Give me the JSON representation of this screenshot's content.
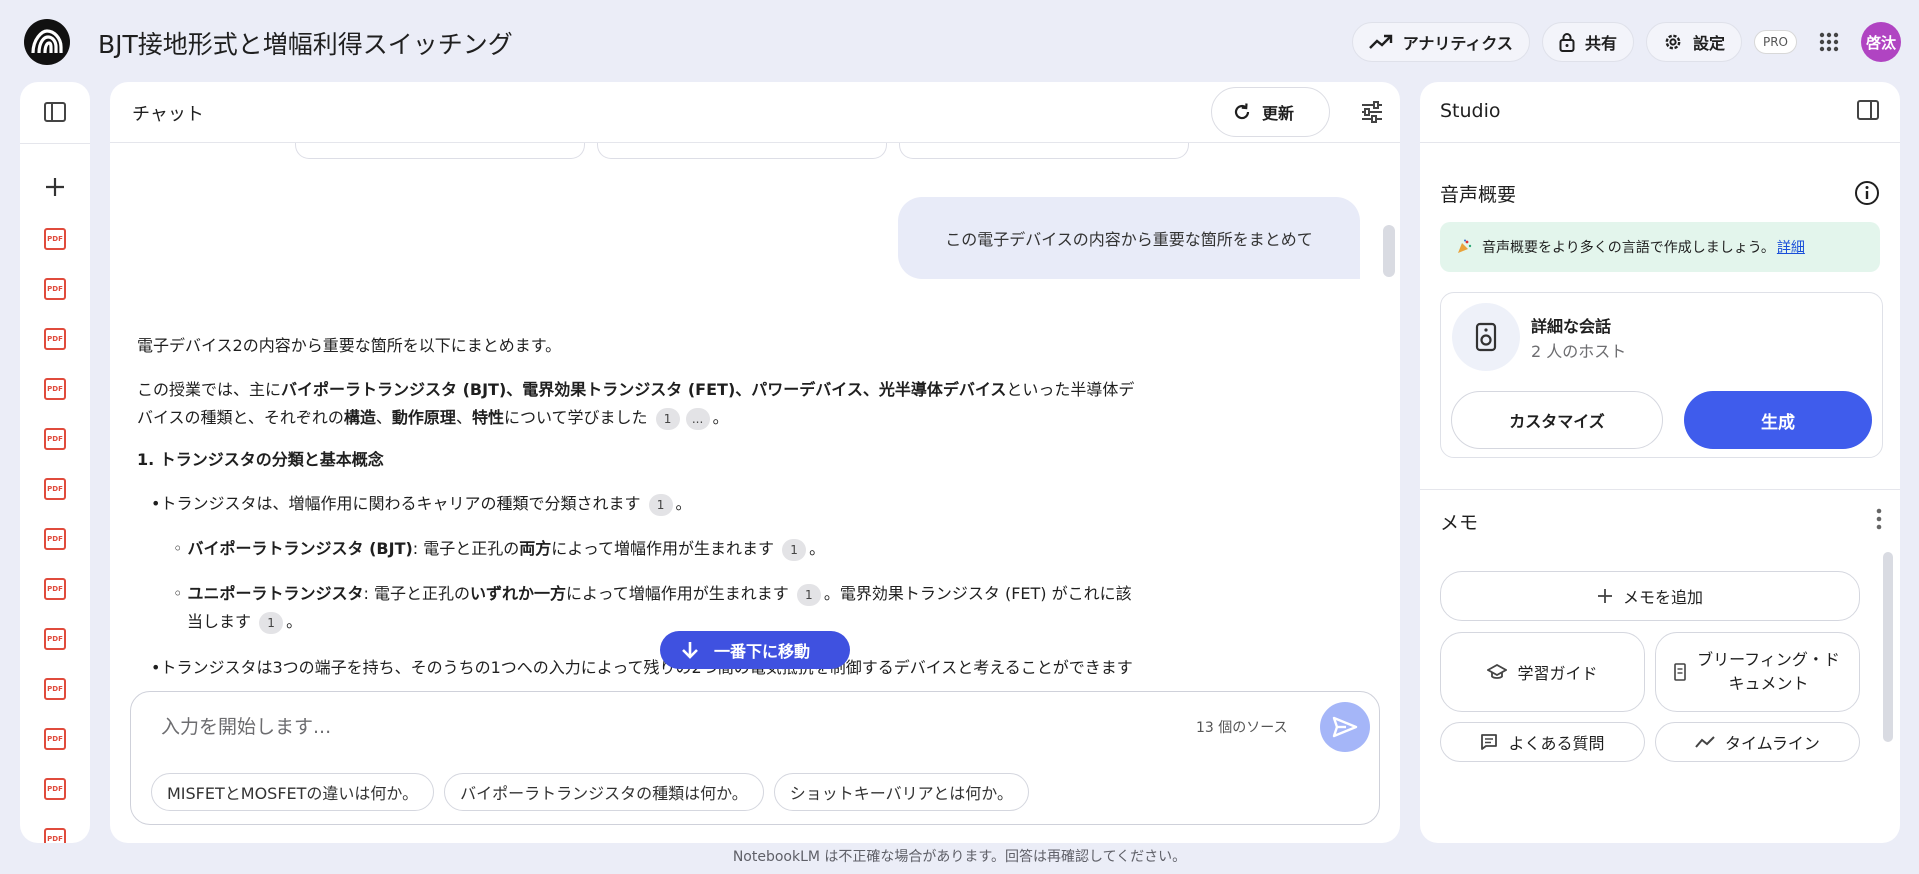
{
  "header": {
    "title": "BJT接地形式と増幅利得スイッチング",
    "analytics_label": "アナリティクス",
    "share_label": "共有",
    "settings_label": "設定",
    "pro_label": "PRO",
    "avatar_initials": "啓汰"
  },
  "chat": {
    "title": "チャット",
    "refresh_label": "更新",
    "user_message": "この電子デバイスの内容から重要な箇所をまとめて",
    "answer": {
      "intro": "電子デバイス2の内容から重要な箇所を以下にまとめます。",
      "p1_a": "この授業では、主に",
      "p1_b1": "バイポーラトランジスタ (BJT)",
      "p1_sep1": "、",
      "p1_b2": "電界効果トランジスタ (FET)",
      "p1_sep2": "、",
      "p1_b3": "パワーデバイス",
      "p1_sep3": "、",
      "p1_b4": "光半導体デバイス",
      "p1_c": "といった半導体デ",
      "p1_d": "バイスの種類と、それぞれの",
      "p1_b5": "構造",
      "p1_sep4": "、",
      "p1_b6": "動作原理",
      "p1_sep5": "、",
      "p1_b7": "特性",
      "p1_e": "について学びました",
      "cite_1": "1",
      "cite_more": "...",
      "end_dot": "。",
      "h1": "1. トランジスタの分類と基本概念",
      "bullet1": "トランジスタは、増幅作用に関わるキャリアの種類で分類されます",
      "sub1_b": "バイポーラトランジスタ (BJT)",
      "sub1_a": ": 電子と正孔の",
      "sub1_b2": "両方",
      "sub1_c": "によって増幅作用が生まれます",
      "sub2_b": "ユニポーラトランジスタ",
      "sub2_a": ": 電子と正孔の",
      "sub2_b2": "いずれか一方",
      "sub2_c": "によって増幅作用が生まれます",
      "sub2_d": "。電界効果トランジスタ (FET) がこれに該",
      "sub2_e": "当します",
      "bullet2": "トランジスタは3つの端子を持ち、そのうちの1つへの入力によって残りの2つ間の電気抵抗を制御するデバイスと考えることができます"
    },
    "scroll_down_label": "一番下に移動",
    "input": {
      "placeholder": "入力を開始します...",
      "source_count": "13 個のソース"
    },
    "suggestions": [
      "MISFETとMOSFETの違いは何か。",
      "バイポーラトランジスタの種類は何か。",
      "ショットキーバリアとは何か。"
    ],
    "disclaimer": "NotebookLM は不正確な場合があります。回答は再確認してください。"
  },
  "left_rail": {
    "pdf_label": "PDF",
    "pdf_count": 13
  },
  "studio": {
    "title": "Studio",
    "audio_section_title": "音声概要",
    "banner_text": "音声概要をより多くの言語で作成しましょう。",
    "banner_link": "詳細",
    "conversation_title": "詳細な会話",
    "conversation_subtitle": "2 人のホスト",
    "customize_label": "カスタマイズ",
    "generate_label": "生成",
    "memo_section_title": "メモ",
    "add_memo_label": "メモを追加",
    "study_guide_label": "学習ガイド",
    "briefing_label": "ブリーフィング・ドキュメント",
    "faq_label": "よくある質問",
    "timeline_label": "タイムライン"
  },
  "colors": {
    "accent": "#3f5cec",
    "pdf_red": "#e04b3c",
    "avatar": "#b044c2"
  }
}
